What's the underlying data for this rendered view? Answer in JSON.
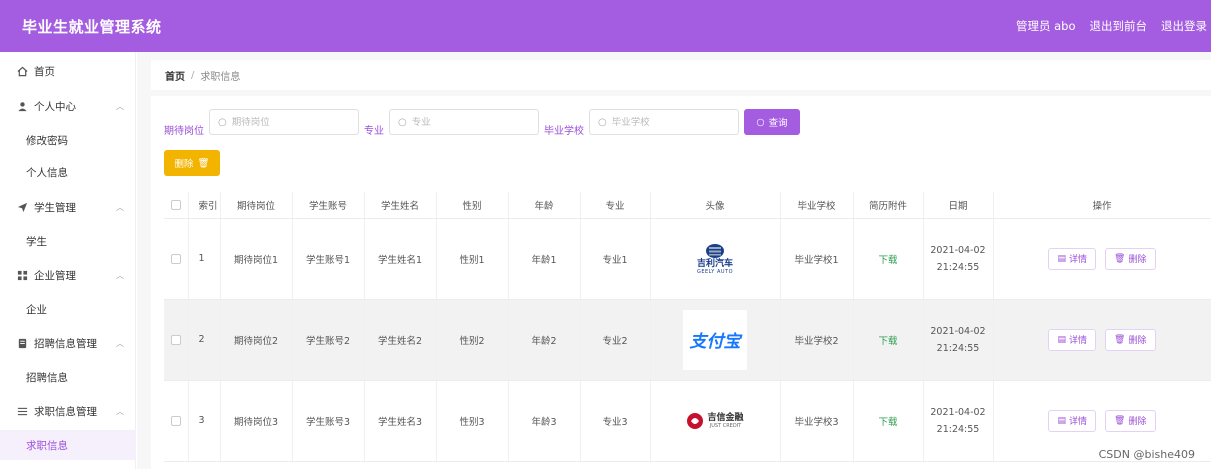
{
  "app": {
    "title": "毕业生就业管理系统",
    "admin_label": "管理员 abo",
    "to_frontend": "退出到前台",
    "logout": "退出登录",
    "accent_color": "#a45de0"
  },
  "sidebar": {
    "home": {
      "label": "首页",
      "icon": "home-icon"
    },
    "groups": [
      {
        "label": "个人中心",
        "icon": "user-icon",
        "children": [
          "修改密码",
          "个人信息"
        ]
      },
      {
        "label": "学生管理",
        "icon": "send-icon",
        "children": [
          "学生"
        ]
      },
      {
        "label": "企业管理",
        "icon": "grid-icon",
        "children": [
          "企业"
        ]
      },
      {
        "label": "招聘信息管理",
        "icon": "file-icon",
        "children": [
          "招聘信息"
        ]
      },
      {
        "label": "求职信息管理",
        "icon": "list-icon",
        "children": [
          "求职信息"
        ]
      }
    ]
  },
  "breadcrumb": {
    "home": "首页",
    "separator": "/",
    "current": "求职信息"
  },
  "search": {
    "fields": [
      {
        "label": "期待岗位",
        "placeholder": "期待岗位"
      },
      {
        "label": "专业",
        "placeholder": "专业"
      },
      {
        "label": "毕业学校",
        "placeholder": "毕业学校"
      }
    ],
    "query_button": "查询"
  },
  "toolbar": {
    "delete_button": "删除"
  },
  "table": {
    "columns": [
      "",
      "索引",
      "期待岗位",
      "学生账号",
      "学生姓名",
      "性别",
      "年龄",
      "专业",
      "头像",
      "毕业学校",
      "简历附件",
      "日期",
      "操作"
    ],
    "rows": [
      {
        "index": "1",
        "post": "期待岗位1",
        "account": "学生账号1",
        "name": "学生姓名1",
        "gender": "性别1",
        "age": "年龄1",
        "major": "专业1",
        "avatar": "geely",
        "avatar_text": "吉利汽车",
        "avatar_sub": "GEELY AUTO",
        "school": "毕业学校1",
        "attachment": "下载",
        "date1": "2021-04-02",
        "date2": "21:24:55",
        "detail": "详情",
        "delete": "删除"
      },
      {
        "index": "2",
        "post": "期待岗位2",
        "account": "学生账号2",
        "name": "学生姓名2",
        "gender": "性别2",
        "age": "年龄2",
        "major": "专业2",
        "avatar": "alipay",
        "avatar_text": "支付宝",
        "avatar_sub": "",
        "school": "毕业学校2",
        "attachment": "下载",
        "date1": "2021-04-02",
        "date2": "21:24:55",
        "detail": "详情",
        "delete": "删除"
      },
      {
        "index": "3",
        "post": "期待岗位3",
        "account": "学生账号3",
        "name": "学生姓名3",
        "gender": "性别3",
        "age": "年龄3",
        "major": "专业3",
        "avatar": "credit",
        "avatar_text": "吉信金融",
        "avatar_sub": "JUST CREDIT",
        "school": "毕业学校3",
        "attachment": "下载",
        "date1": "2021-04-02",
        "date2": "21:24:55",
        "detail": "详情",
        "delete": "删除"
      }
    ]
  },
  "watermark": "CSDN @bishe409"
}
